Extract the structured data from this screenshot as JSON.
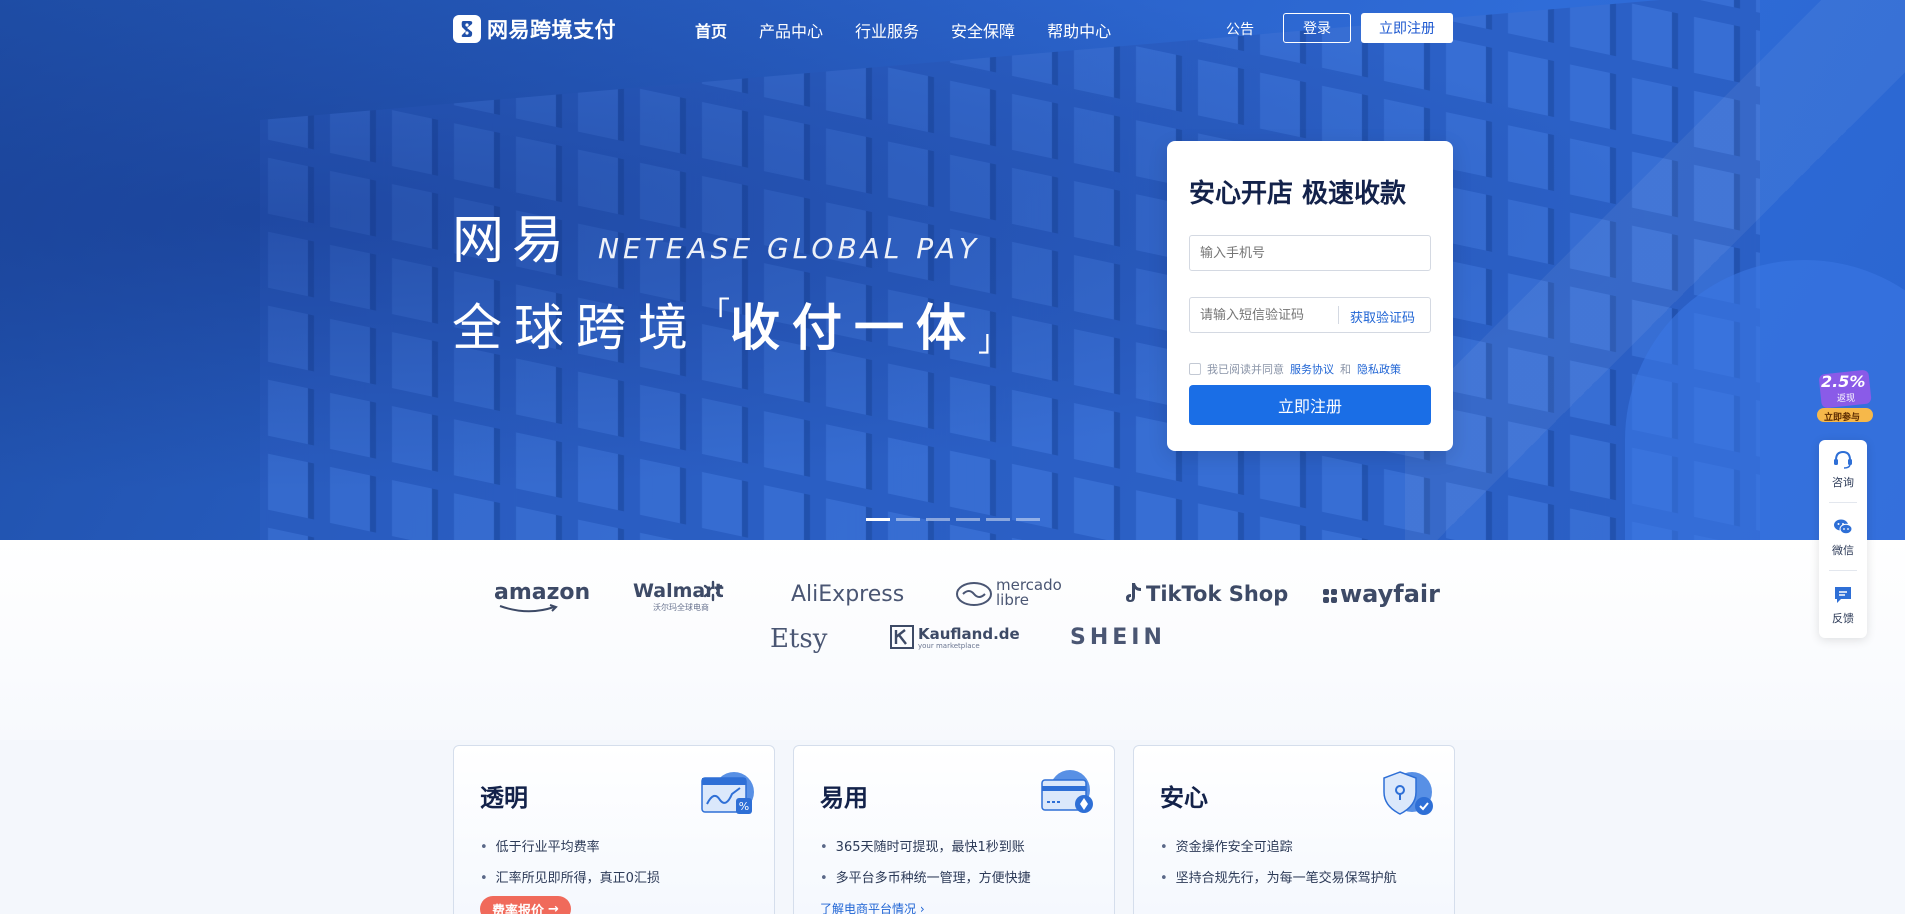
{
  "brand": {
    "name": "网易跨境支付"
  },
  "nav": {
    "items": [
      {
        "label": "首页",
        "active": true
      },
      {
        "label": "产品中心"
      },
      {
        "label": "行业服务"
      },
      {
        "label": "安全保障"
      },
      {
        "label": "帮助中心"
      }
    ],
    "announce": "公告",
    "login": "登录",
    "signup": "立即注册"
  },
  "hero": {
    "cn_title": "网易",
    "en_title": "NETEASE GLOBAL PAY",
    "line2_prefix": "全球跨境",
    "line2_bracket_open": "「",
    "line2_highlight": "收付一体",
    "line2_bracket_close": "」",
    "slides": 6,
    "active_slide": 1
  },
  "form": {
    "title": "安心开店 极速收款",
    "phone_placeholder": "输入手机号",
    "code_placeholder": "请输入短信验证码",
    "get_code": "获取验证码",
    "agree_prefix": "我已阅读并同意",
    "agree_link1": "服务协议",
    "agree_and": "和",
    "agree_link2": "隐私政策",
    "submit": "立即注册"
  },
  "partners": [
    "amazon",
    "Walmart",
    "沃尔玛全球电商",
    "AliExpress",
    "mercado",
    "libre",
    "TikTok Shop",
    "wayfair",
    "Etsy",
    "Kaufland.de",
    "your marketplace",
    "SHEIN"
  ],
  "cards": [
    {
      "title": "透明",
      "items": [
        "低于行业平均费率",
        "汇率所见即所得，真正0汇损"
      ],
      "pill": "费率报价"
    },
    {
      "title": "易用",
      "items": [
        "365天随时可提现，最快1秒到账",
        "多平台多币种统一管理，方便快捷"
      ],
      "link": "了解电商平台情况 ›"
    },
    {
      "title": "安心",
      "items": [
        "资金操作安全可追踪",
        "坚持合规先行，为每一笔交易保驾护航"
      ]
    }
  ],
  "float": {
    "promo_rate": "2.5%",
    "promo_sub": "返现",
    "promo_btn": "立即参与",
    "items": [
      "咨询",
      "微信",
      "反馈"
    ]
  },
  "colors": {
    "primary": "#1a6ee6",
    "hero": "#2a62c9",
    "accent": "#f06a5b"
  }
}
